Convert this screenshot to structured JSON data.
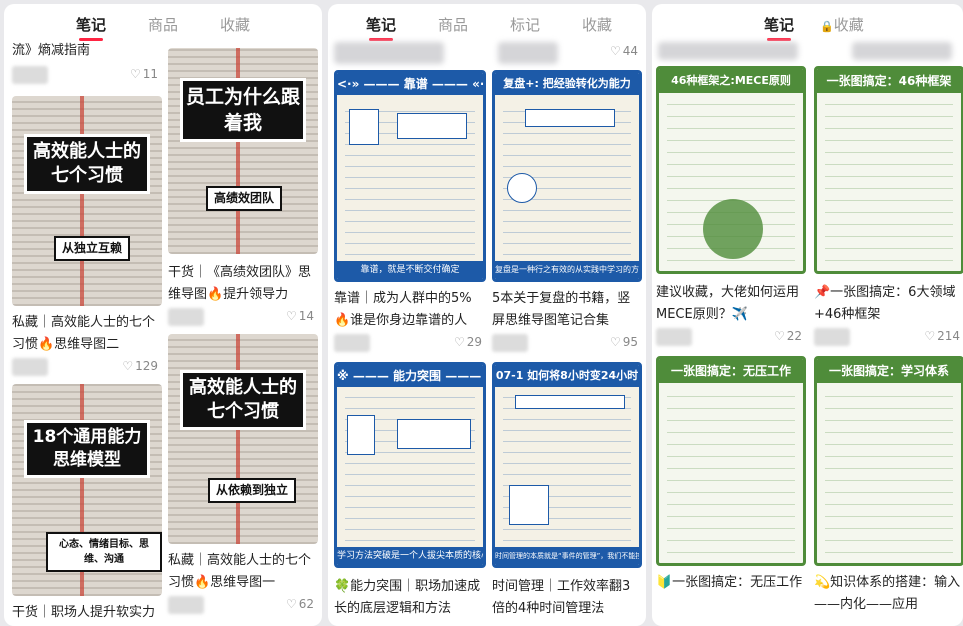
{
  "panels": [
    {
      "tabs": [
        "笔记",
        "商品",
        "收藏"
      ],
      "active": 0
    },
    {
      "tabs": [
        "笔记",
        "商品",
        "标记",
        "收藏"
      ],
      "active": 0
    },
    {
      "tabs": [
        "笔记",
        "收藏"
      ],
      "active": 0,
      "lock_icon": "lock-icon"
    }
  ],
  "p1": {
    "top_left_title": "流》熵减指南",
    "top_left_likes": "11",
    "card_7habits": {
      "banner": "高效能人士的七个习惯",
      "sub": "从独立互赖",
      "title": "私藏｜高效能人士的七个习惯🔥思维导图二",
      "likes": "129"
    },
    "card_18models": {
      "banner": "18个通用能力思维模型",
      "sub": "心态、情绪目标、思维、沟通",
      "title": "干货｜职场人提升软实力"
    },
    "card_team": {
      "banner": "员工为什么跟着我",
      "sub": "高绩效团队",
      "title": "干货｜《高绩效团队》思维导图🔥提升领导力",
      "likes": "14"
    },
    "card_7habits1": {
      "banner": "高效能人士的七个习惯",
      "sub": "从依赖到独立",
      "title": "私藏｜高效能人士的七个习惯🔥思维导图一",
      "likes": "62"
    }
  },
  "p2": {
    "top_right_likes": "44",
    "card_reliable": {
      "header": "<·» ——— 靠谱 ——— «·>",
      "footer": "靠谱，就是不断交付确定",
      "title": "靠谱｜成为人群中的5%🔥谁是你身边靠谱的人",
      "likes": "29"
    },
    "card_review": {
      "header": "复盘+: 把经验转化为能力",
      "footer": "复盘是一种行之有效的从实践中学习的方法",
      "title": "5本关于复盘的书籍，竖屏思维导图笔记合集",
      "likes": "95"
    },
    "card_ability": {
      "header": "※ ——— 能力突围 ——— ※",
      "footer": "学习方法突破是一个人拔尖本质的核心竞争力",
      "title": "🍀能力突围｜职场加速成长的底层逻辑和方法"
    },
    "card_time": {
      "header": "07-1 如何将8小时变24小时",
      "footer": "时间管理的本质就是“事件的管理”，我们不能控制时间，但是可以控制何时做事和做什么事",
      "title": "时间管理｜工作效率翻3倍的4种时间管理法"
    }
  },
  "p3": {
    "card_mece": {
      "header": "46种框架之:MECE原则",
      "title": "建议收藏，大佬如何运用MECE原则？✈️",
      "likes": "22"
    },
    "card_46": {
      "header": "一张图搞定：46种框架",
      "title": "📌一张图搞定：6大领域+46种框架",
      "likes": "214"
    },
    "card_wuya": {
      "header": "一张图搞定：无压工作",
      "title": "🔰一张图搞定：无压工作"
    },
    "card_learn": {
      "header": "一张图搞定：学习体系",
      "title": "💫知识体系的搭建：输入——内化——应用"
    }
  },
  "icons": {
    "heart": "♡",
    "lock": "🔒"
  }
}
